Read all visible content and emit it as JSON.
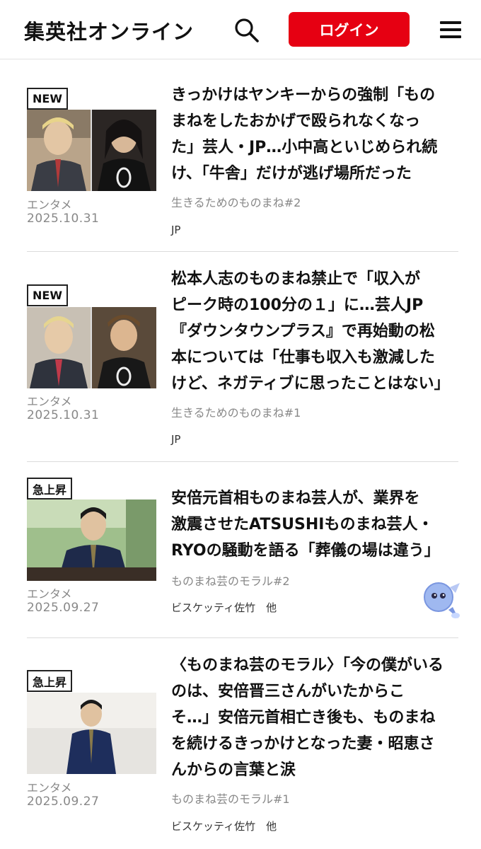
{
  "header": {
    "logo": "集英社オンライン",
    "login_label": "ログイン"
  },
  "articles": [
    {
      "badge": "NEW",
      "category": "エンタメ",
      "date": "2025.10.31",
      "title_lines": [
        "きっかけはヤンキーからの強制「もの",
        "まねをしたおかげで殴られなくなっ",
        "た」芸人・JP…小中高といじめられ続",
        "け、「牛舎」だけが逃げ場所だった"
      ],
      "series": "生きるためのものまね#2",
      "author": "JP"
    },
    {
      "badge": "NEW",
      "category": "エンタメ",
      "date": "2025.10.31",
      "title_lines": [
        "松本人志のものまね禁止で「収入が",
        "ピーク時の100分の１」に…芸人JP",
        "『ダウンタウンプラス』で再始動の松",
        "本については「仕事も収入も激減した",
        "けど、ネガティブに思ったことはない」"
      ],
      "series": "生きるためのものまね#1",
      "author": "JP"
    },
    {
      "badge": "急上昇",
      "category": "エンタメ",
      "date": "2025.09.27",
      "title_lines": [
        "安倍元首相ものまね芸人が、業界を",
        "激震させたATSUSHIものまね芸人・",
        "RYOの騒動を語る「葬儀の場は違う」"
      ],
      "series": "ものまね芸のモラル#2",
      "author": "ビスケッティ佐竹　他"
    },
    {
      "badge": "急上昇",
      "category": "エンタメ",
      "date": "2025.09.27",
      "title_lines": [
        "〈ものまね芸のモラル〉「今の僕がいる",
        "のは、安倍晋三さんがいたからこ",
        "そ…」安倍元首相亡き後も、ものまね",
        "を続けるきっかけとなった妻・昭恵さ",
        "んからの言葉と涙"
      ],
      "series": "ものまね芸のモラル#1",
      "author": "ビスケッティ佐竹　他"
    }
  ],
  "icons": {
    "search": "search-icon",
    "menu": "hamburger-menu-icon",
    "float": "mascot-icon"
  },
  "colors": {
    "brand_red": "#e60012",
    "text_gray": "#888888"
  }
}
